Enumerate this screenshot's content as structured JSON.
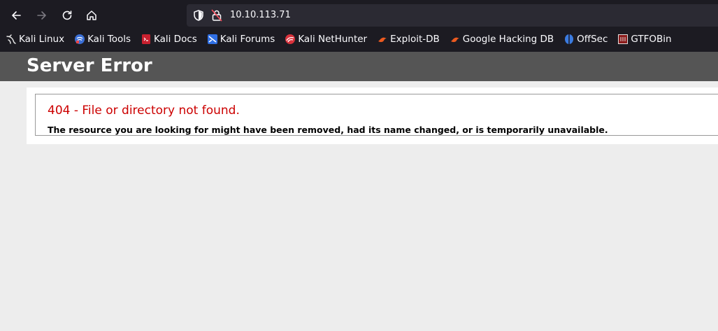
{
  "browser": {
    "url": "10.10.113.71",
    "nav": {
      "back": "back-arrow-icon",
      "forward": "forward-arrow-icon",
      "reload": "reload-icon",
      "home": "home-icon"
    },
    "bookmarks": [
      {
        "label": "Kali Linux",
        "icon": "kali-dragon-icon"
      },
      {
        "label": "Kali Tools",
        "icon": "kali-tools-icon"
      },
      {
        "label": "Kali Docs",
        "icon": "kali-docs-icon"
      },
      {
        "label": "Kali Forums",
        "icon": "kali-forums-icon"
      },
      {
        "label": "Kali NetHunter",
        "icon": "kali-nethunter-icon"
      },
      {
        "label": "Exploit-DB",
        "icon": "exploit-db-icon"
      },
      {
        "label": "Google Hacking DB",
        "icon": "google-hacking-db-icon"
      },
      {
        "label": "OffSec",
        "icon": "offsec-icon"
      },
      {
        "label": "GTFOBin",
        "icon": "gtfobin-icon"
      }
    ]
  },
  "page": {
    "title": "Server Error",
    "error_heading": "404 - File or directory not found.",
    "error_body": "The resource you are looking for might have been removed, had its name changed, or is temporarily unavailable."
  },
  "colors": {
    "chrome_bg": "#1c1b22",
    "urlbar_bg": "#2b2a33",
    "header_bg": "#555555",
    "error_red": "#cc0000",
    "page_bg": "#ededed"
  }
}
